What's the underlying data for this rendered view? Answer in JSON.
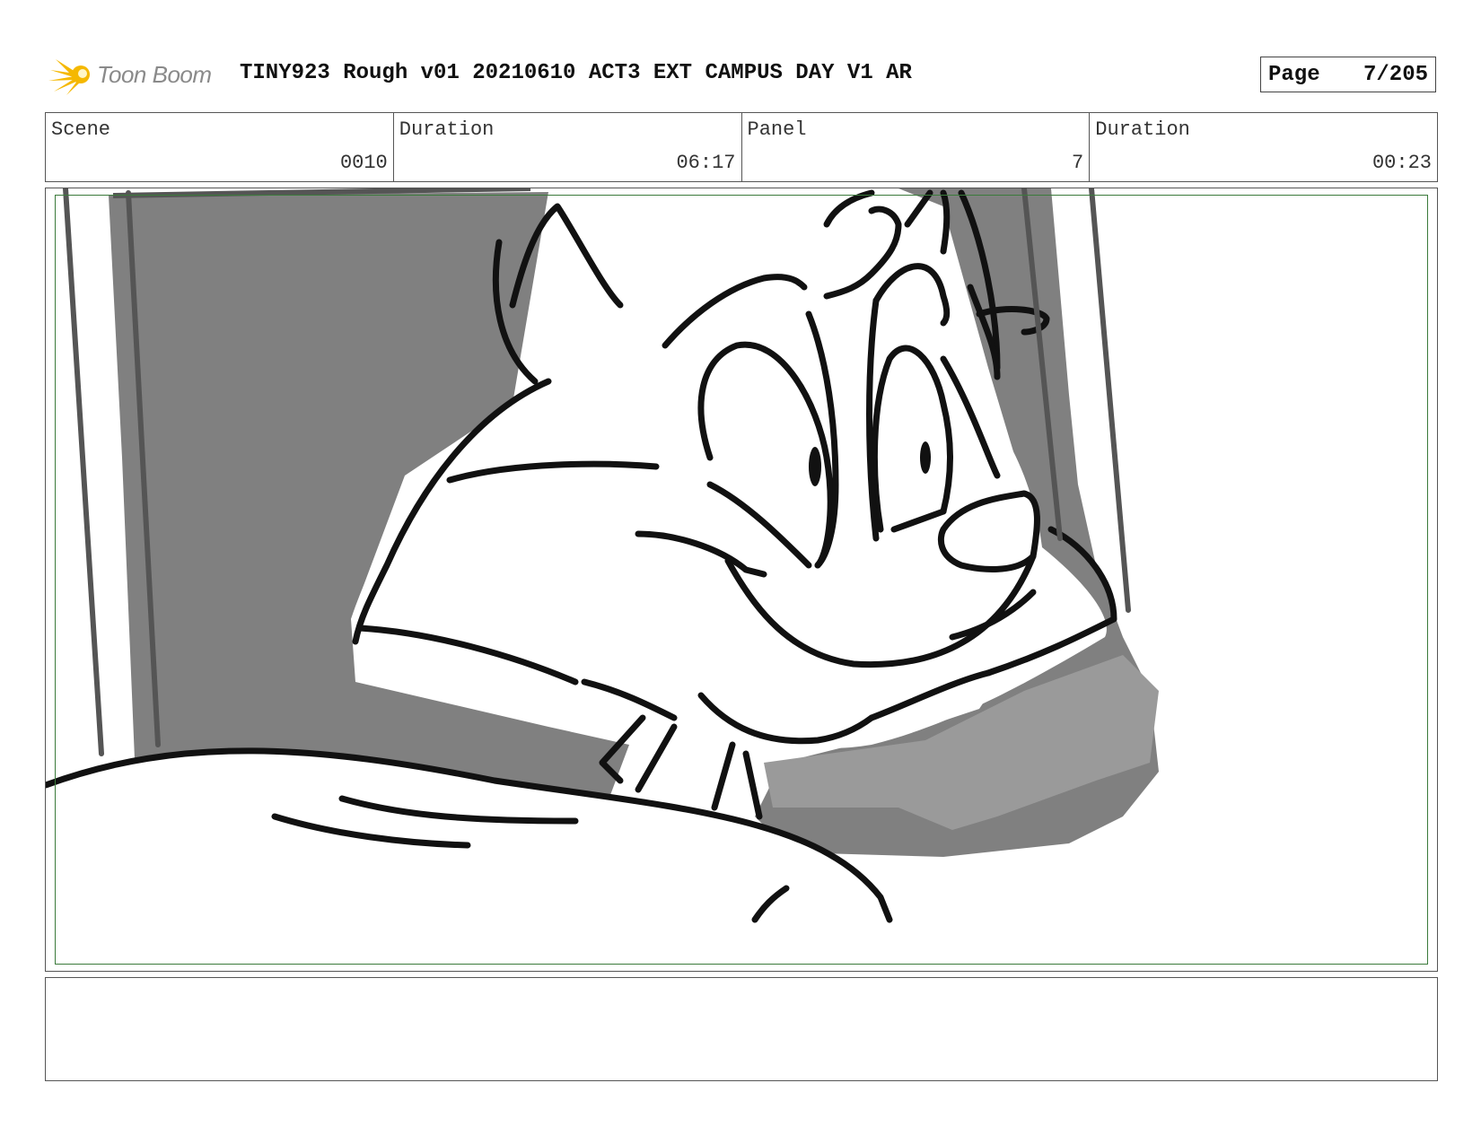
{
  "header": {
    "logo_text": "Toon Boom",
    "title": "TINY923 Rough v01 20210610 ACT3 EXT CAMPUS DAY V1 AR",
    "page_label": "Page",
    "page_value": "7/205"
  },
  "info": {
    "scene_label": "Scene",
    "scene_value": "0010",
    "scene_duration_label": "Duration",
    "scene_duration_value": "06:17",
    "panel_label": "Panel",
    "panel_value": "7",
    "panel_duration_label": "Duration",
    "panel_duration_value": "00:23"
  },
  "notes": {
    "text": ""
  },
  "colors": {
    "logo_star": "#f5b800",
    "safe_frame": "#3b7a3b",
    "shadow_dark": "#808080",
    "shadow_light": "#9a9a9a"
  }
}
